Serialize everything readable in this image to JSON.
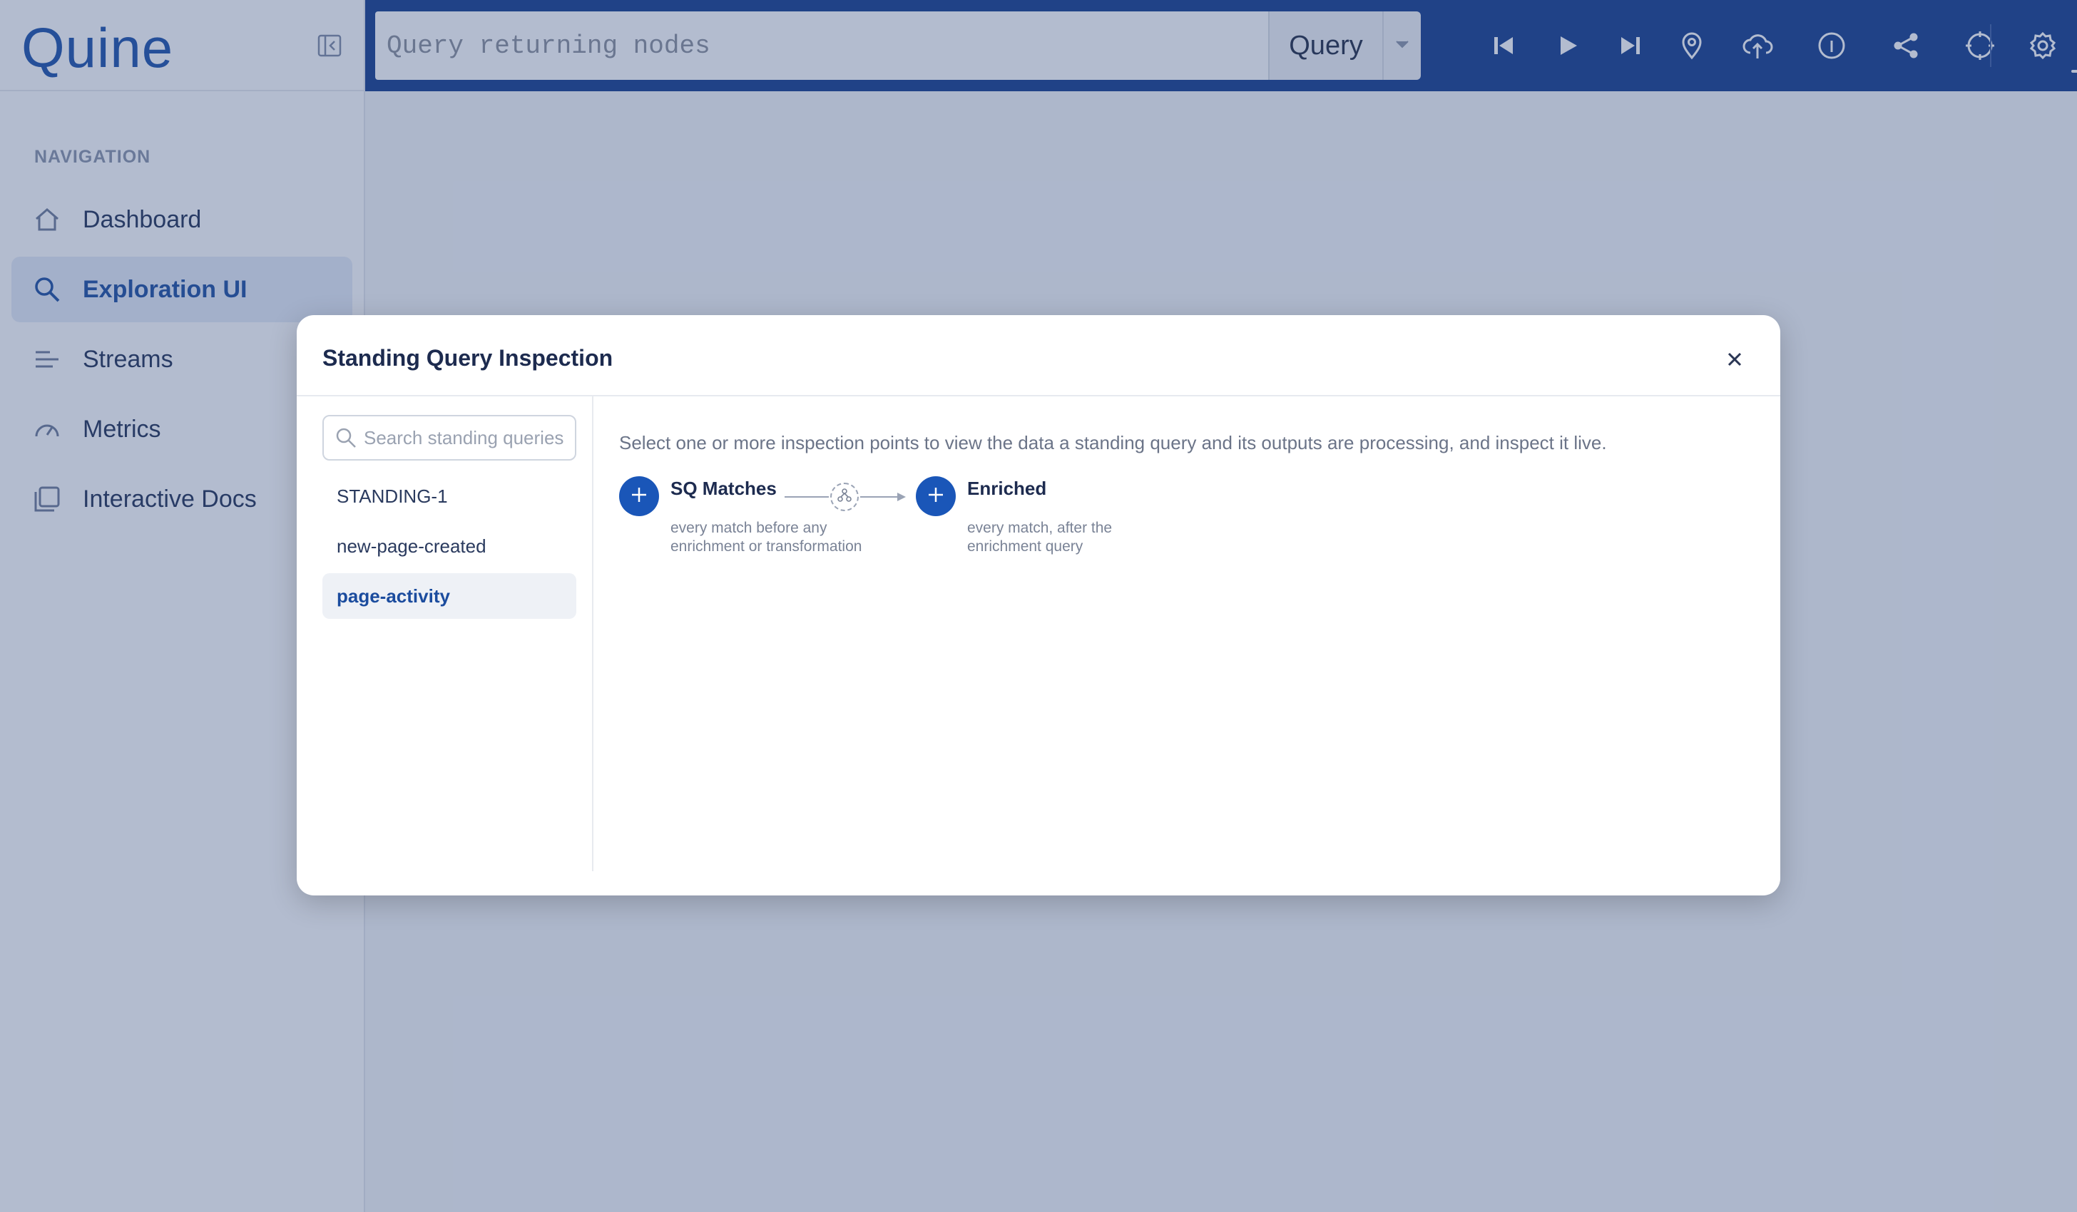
{
  "app": {
    "logo_text": "Quine"
  },
  "sidebar": {
    "nav_title": "NAVIGATION",
    "items": [
      {
        "label": "Dashboard",
        "icon": "home-icon",
        "active": false
      },
      {
        "label": "Exploration UI",
        "icon": "search-icon",
        "active": true
      },
      {
        "label": "Streams",
        "icon": "streams-icon",
        "active": false
      },
      {
        "label": "Metrics",
        "icon": "gauge-icon",
        "active": false
      },
      {
        "label": "Interactive Docs",
        "icon": "docs-icon",
        "active": false
      }
    ]
  },
  "topbar": {
    "query_placeholder": "Query returning nodes",
    "query_button": "Query",
    "icons": [
      "skip-back-icon",
      "play-icon",
      "skip-forward-icon",
      "pin-icon",
      "cloud-upload-icon",
      "info-icon",
      "share-icon",
      "crosshair-icon",
      "gear-icon"
    ]
  },
  "modal": {
    "title": "Standing Query Inspection",
    "search_placeholder": "Search standing queries",
    "queries": [
      "STANDING-1",
      "new-page-created",
      "page-activity"
    ],
    "selected_query": "page-activity",
    "help_text": "Select one or more inspection points to view the data a standing query and its outputs are processing, and inspect it live.",
    "steps": [
      {
        "title": "SQ Matches",
        "desc": "every match before any enrichment or transformation"
      },
      {
        "title": "Enriched",
        "desc": "every match, after the enrichment query"
      }
    ]
  },
  "colors": {
    "brand": "#123b8c",
    "accent": "#1a56b8",
    "overlay": "rgba(54,80,130,0.38)"
  }
}
